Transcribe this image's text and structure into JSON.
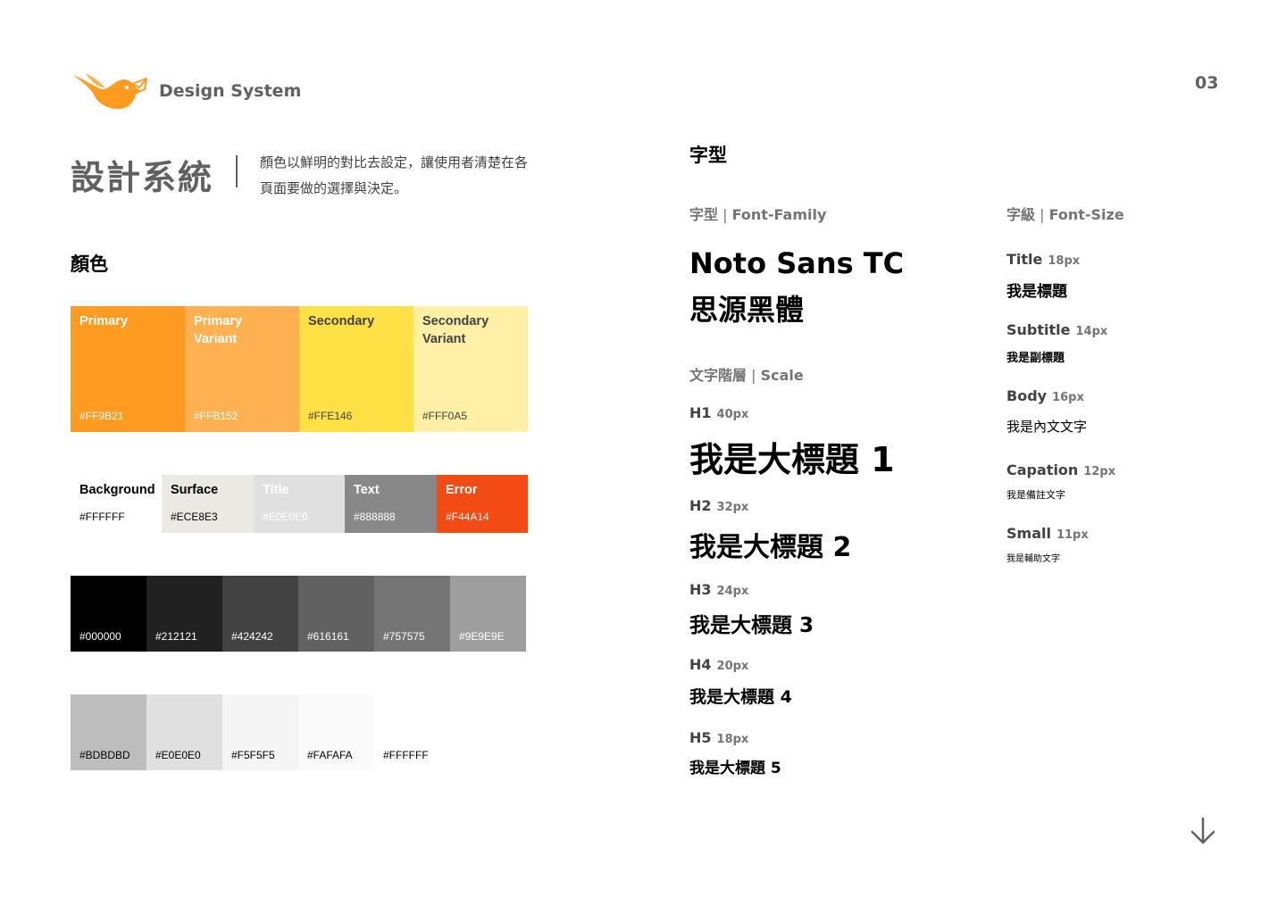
{
  "header": {
    "brand": "Design System",
    "page_number": "03"
  },
  "intro": {
    "title": "設計系統",
    "description": "顏色以鮮明的對比去設定，讓使用者清楚在各頁面要做的選擇與決定。"
  },
  "colors": {
    "heading": "顏色",
    "main": [
      {
        "label": "Primary",
        "hex": "#FF9B21",
        "color": "#FF9B21"
      },
      {
        "label": "Primary Variant",
        "hex": "#FFB152",
        "color": "#FFB152"
      },
      {
        "label": "Secondary",
        "hex": "#FFE146",
        "color": "#FFE146"
      },
      {
        "label": "Secondary Variant",
        "hex": "#FFF0A5",
        "color": "#FFF0A5"
      }
    ],
    "semantic": [
      {
        "label": "Background",
        "hex": "#FFFFFF",
        "color": "#FFFFFF"
      },
      {
        "label": "Surface",
        "hex": "#ECE8E3",
        "color": "#ECE8E3"
      },
      {
        "label": "Title",
        "hex": "#E0E0E0",
        "color": "#E0E0E0"
      },
      {
        "label": "Text",
        "hex": "#888888",
        "color": "#888888"
      },
      {
        "label": "Error",
        "hex": "#F44A14",
        "color": "#F44A14"
      }
    ],
    "grays_dark": [
      "#000000",
      "#212121",
      "#424242",
      "#616161",
      "#757575",
      "#9E9E9E"
    ],
    "grays_light": [
      "#BDBDBD",
      "#E0E0E0",
      "#F5F5F5",
      "#FAFAFA",
      "#FFFFFF"
    ]
  },
  "typography": {
    "heading": "字型",
    "family_label_cn": "字型",
    "family_label_en": "Font-Family",
    "family_name": "Noto Sans TC",
    "family_name_cn": "思源黑體",
    "scale_label_cn": "文字階層",
    "scale_label_en": "Scale",
    "scale": [
      {
        "tag": "H1",
        "size": "40px",
        "sample": "我是大標題 1"
      },
      {
        "tag": "H2",
        "size": "32px",
        "sample": "我是大標題 2"
      },
      {
        "tag": "H3",
        "size": "24px",
        "sample": "我是大標題 3"
      },
      {
        "tag": "H4",
        "size": "20px",
        "sample": "我是大標題 4"
      },
      {
        "tag": "H5",
        "size": "18px",
        "sample": "我是大標題 5"
      }
    ],
    "size_label_cn": "字級",
    "size_label_en": "Font-Size",
    "sizes": [
      {
        "tag": "Title",
        "size": "18px",
        "sample": "我是標題"
      },
      {
        "tag": "Subtitle",
        "size": "14px",
        "sample": "我是副標題"
      },
      {
        "tag": "Body",
        "size": "16px",
        "sample": "我是內文文字"
      },
      {
        "tag": "Capation",
        "size": "12px",
        "sample": "我是備註文字"
      },
      {
        "tag": "Small",
        "size": "11px",
        "sample": "我是輔助文字"
      }
    ]
  },
  "icons": {
    "logo": "bird-logo",
    "scroll": "arrow-down-icon"
  }
}
